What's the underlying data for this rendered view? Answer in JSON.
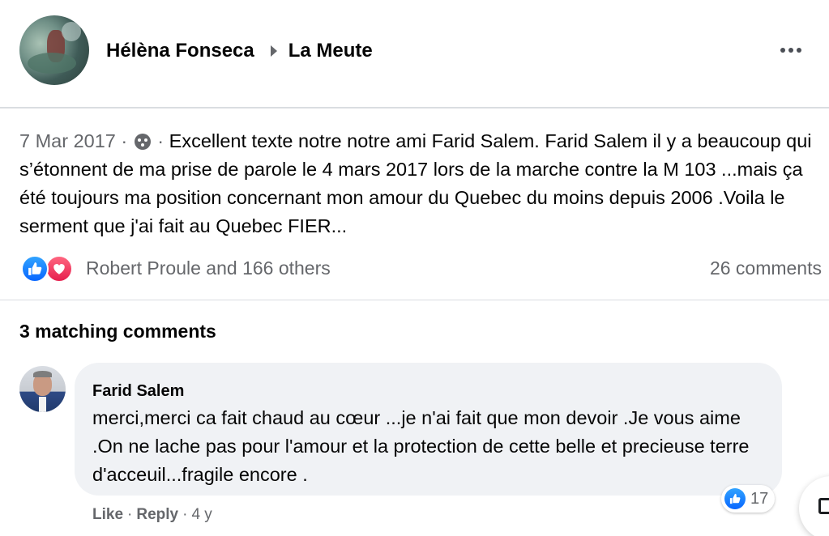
{
  "post": {
    "author": "Hélèna Fonseca",
    "group": "La Meute",
    "date": "7 Mar 2017",
    "privacy_icon": "group-members-icon",
    "text": "Excellent texte notre notre ami Farid Salem. Farid Salem il y a beaucoup qui s’étonnent de ma prise de parole le 4 mars 2017 lors de la marche contre la M 103 ...mais ça été toujours ma position concernant mon amour du Quebec du moins depuis 2006 .Voila le serment que j'ai fait au Quebec FIER...",
    "reaction_icons": [
      "like-icon",
      "love-icon"
    ],
    "reactions_text": "Robert Proule and 166 others",
    "comments_count": "26 comments"
  },
  "comments_section": {
    "heading": "3 matching comments",
    "comments": [
      {
        "author": "Farid Salem",
        "text": "merci,merci ca fait chaud au cœur ...je n'ai fait que mon devoir .Je vous aime .On ne lache pas pour l'amour et la protection de cette belle et precieuse terre d'acceuil...fragile encore .",
        "reaction_icon": "like-icon",
        "reaction_count": "17",
        "like_label": "Like",
        "reply_label": "Reply",
        "age": "4 y"
      }
    ]
  },
  "colors": {
    "like_blue": "#0866ff",
    "love_red": "#e61e4d",
    "secondary_text": "#65676b",
    "bubble_bg": "#f0f2f5"
  }
}
